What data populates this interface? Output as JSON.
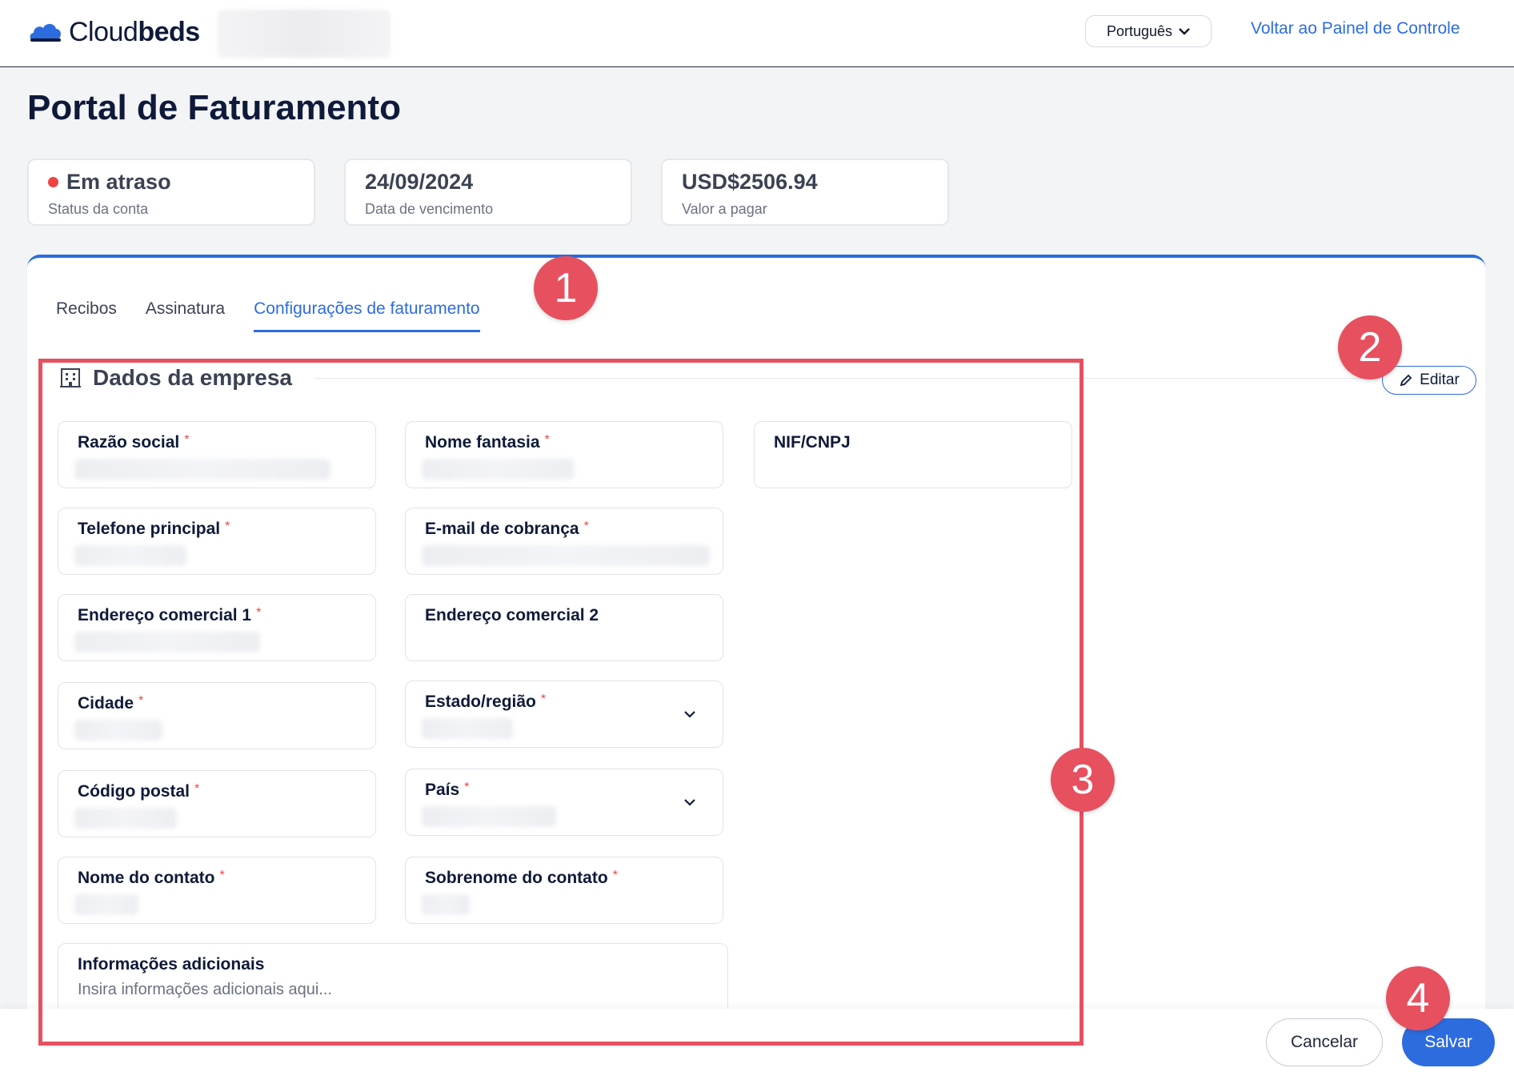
{
  "header": {
    "logo_text_light": "Cloud",
    "logo_text_bold": "beds",
    "language": "Português",
    "back_link": "Voltar ao Painel de Controle"
  },
  "page_title": "Portal de Faturamento",
  "status_cards": [
    {
      "value": "Em atraso",
      "label": "Status da conta",
      "indicator_color": "#ef4444"
    },
    {
      "value": "24/09/2024",
      "label": "Data de vencimento"
    },
    {
      "value": "USD$2506.94",
      "label": "Valor a pagar"
    }
  ],
  "tabs": [
    {
      "label": "Recibos",
      "active": false
    },
    {
      "label": "Assinatura",
      "active": false
    },
    {
      "label": "Configurações de faturamento",
      "active": true
    }
  ],
  "section": {
    "title": "Dados da empresa",
    "icon": "building-icon",
    "edit_label": "Editar"
  },
  "fields": {
    "razao_social": {
      "label": "Razão social",
      "required": true
    },
    "nome_fantasia": {
      "label": "Nome fantasia",
      "required": true
    },
    "nif_cnpj": {
      "label": "NIF/CNPJ",
      "required": false
    },
    "telefone": {
      "label": "Telefone principal",
      "required": true
    },
    "email": {
      "label": "E-mail de cobrança",
      "required": true
    },
    "endereco1": {
      "label": "Endereço comercial 1",
      "required": true
    },
    "endereco2": {
      "label": "Endereço comercial 2",
      "required": false
    },
    "cidade": {
      "label": "Cidade",
      "required": true
    },
    "estado": {
      "label": "Estado/região",
      "required": true
    },
    "cep": {
      "label": "Código postal",
      "required": true
    },
    "pais": {
      "label": "País",
      "required": true
    },
    "nome_contato": {
      "label": "Nome do contato",
      "required": true
    },
    "sobrenome_contato": {
      "label": "Sobrenome do contato",
      "required": true
    },
    "info_adicional": {
      "label": "Informações adicionais",
      "placeholder": "Insira informações adicionais aqui..."
    }
  },
  "required_mark": "*",
  "footer": {
    "cancel_label": "Cancelar",
    "save_label": "Salvar"
  },
  "annotations": [
    "1",
    "2",
    "3",
    "4"
  ],
  "colors": {
    "accent": "#2d6cdf",
    "annotation": "#e7505f",
    "required": "#ef4444"
  }
}
